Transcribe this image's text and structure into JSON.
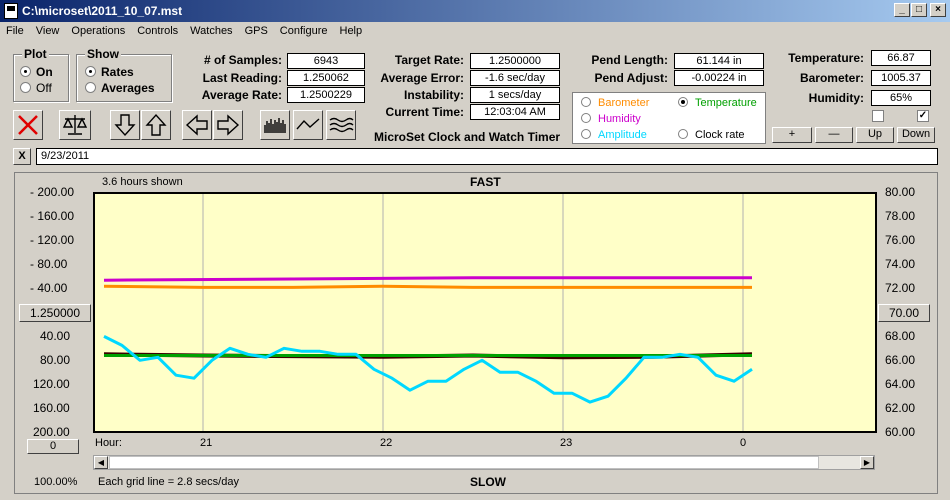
{
  "window": {
    "title": "C:\\microset\\2011_10_07.mst",
    "btn_min": "_",
    "btn_max": "□",
    "btn_close": "×"
  },
  "menu": [
    "File",
    "View",
    "Operations",
    "Controls",
    "Watches",
    "GPS",
    "Configure",
    "Help"
  ],
  "plot_group": {
    "title": "Plot",
    "on": "On",
    "off": "Off",
    "selected": "On"
  },
  "show_group": {
    "title": "Show",
    "rates": "Rates",
    "averages": "Averages",
    "selected": "Rates"
  },
  "stats": {
    "samples_label": "# of Samples:",
    "samples": "6943",
    "last_reading_label": "Last Reading:",
    "last_reading": "1.250062",
    "average_rate_label": "Average Rate:",
    "average_rate": "1.2500229",
    "target_rate_label": "Target Rate:",
    "target_rate": "1.2500000",
    "average_error_label": "Average Error:",
    "average_error": "-1.6 sec/day",
    "instability_label": "Instability:",
    "instability": "1 secs/day",
    "current_time_label": "Current Time:",
    "current_time": "12:03:04 AM",
    "pend_length_label": "Pend Length:",
    "pend_length": "61.144 in",
    "pend_adjust_label": "Pend Adjust:",
    "pend_adjust": "-0.00224 in",
    "temperature_label": "Temperature:",
    "temperature": "66.87",
    "barometer_label": "Barometer:",
    "barometer": "1005.37",
    "humidity_label": "Humidity:",
    "humidity": "65%"
  },
  "app_label": "MicroSet Clock and Watch Timer",
  "legend": {
    "barometer": "Barometer",
    "temperature": "Temperature",
    "humidity": "Humidity",
    "amplitude": "Amplitude",
    "clock_rate": "Clock rate",
    "selected": "Temperature",
    "colors": {
      "barometer": "#ff8c00",
      "temperature": "#00a000",
      "humidity": "#cc00cc",
      "amplitude": "#00d8ff",
      "clock_rate": "#000000"
    }
  },
  "aux_buttons": {
    "plus": "+",
    "minus": "—",
    "up": "Up",
    "down": "Down"
  },
  "checkboxes": {
    "left_checked": false,
    "right_checked": true
  },
  "note": {
    "close_label": "X",
    "text": "9/23/2011"
  },
  "chart": {
    "hours_shown": "3.6 hours shown",
    "top_label": "FAST",
    "bottom_label": "SLOW",
    "left_ticks": [
      "- 200.00",
      "- 160.00",
      "- 120.00",
      "- 80.00",
      "- 40.00",
      "40.00",
      "80.00",
      "120.00",
      "160.00",
      "200.00"
    ],
    "right_ticks": [
      "80.00",
      "78.00",
      "76.00",
      "74.00",
      "72.00",
      "70.00",
      "68.00",
      "66.00",
      "64.00",
      "62.00",
      "60.00"
    ],
    "center_button": "1.250000",
    "right_button": "70.00",
    "bottom_left_button": "0",
    "x_label": "Hour:",
    "x_ticks": [
      "21",
      "22",
      "23",
      "0"
    ],
    "zoom": "100.00%",
    "grid_note": "Each grid line = 2.8 secs/day",
    "plot_bg": "#ffffc8"
  },
  "chart_data": {
    "type": "line",
    "x_unit": "hour",
    "x_ticks": [
      21,
      22,
      23,
      24
    ],
    "left_axis": {
      "range": [
        -200,
        200
      ],
      "unit": "sec/day",
      "note": "labels show magnitude, fast above, slow below"
    },
    "right_axis": {
      "range": [
        60,
        80
      ]
    },
    "series": [
      {
        "name": "Humidity",
        "color": "#cc00cc",
        "axis": "right",
        "x": [
          20.45,
          21.5,
          22.5,
          23.5,
          24.05
        ],
        "y": [
          72.7,
          72.8,
          72.9,
          72.9,
          72.9
        ]
      },
      {
        "name": "Barometer",
        "color": "#ff8c00",
        "axis": "right",
        "x": [
          20.45,
          21.0,
          21.5,
          22.0,
          22.5,
          23.0,
          23.5,
          24.05
        ],
        "y": [
          72.2,
          72.1,
          72.1,
          72.2,
          72.1,
          72.1,
          72.1,
          72.1
        ]
      },
      {
        "name": "Clock rate",
        "color": "#3a0000",
        "axis": "left",
        "x": [
          20.45,
          21.0,
          21.5,
          22.0,
          22.5,
          23.0,
          23.5,
          24.05
        ],
        "y": [
          70,
          72,
          73,
          74,
          72,
          75,
          74,
          70
        ]
      },
      {
        "name": "Temperature",
        "color": "#00a000",
        "axis": "left",
        "x": [
          20.45,
          21.0,
          21.5,
          22.0,
          22.5,
          23.0,
          23.5,
          24.05
        ],
        "y": [
          72,
          72,
          72,
          72,
          72,
          72,
          72,
          72
        ]
      },
      {
        "name": "Amplitude",
        "color": "#00d8ff",
        "axis": "left",
        "x": [
          20.45,
          20.55,
          20.65,
          20.75,
          20.85,
          20.95,
          21.05,
          21.15,
          21.25,
          21.35,
          21.45,
          21.55,
          21.65,
          21.75,
          21.85,
          21.95,
          22.05,
          22.15,
          22.25,
          22.35,
          22.45,
          22.55,
          22.65,
          22.75,
          22.85,
          22.95,
          23.05,
          23.15,
          23.25,
          23.35,
          23.45,
          23.55,
          23.65,
          23.75,
          23.85,
          23.95,
          24.05
        ],
        "y": [
          40,
          55,
          80,
          75,
          105,
          110,
          80,
          60,
          70,
          75,
          60,
          65,
          65,
          70,
          70,
          95,
          110,
          130,
          115,
          115,
          95,
          80,
          100,
          100,
          115,
          135,
          135,
          150,
          140,
          110,
          75,
          75,
          70,
          75,
          105,
          115,
          95
        ]
      }
    ]
  }
}
